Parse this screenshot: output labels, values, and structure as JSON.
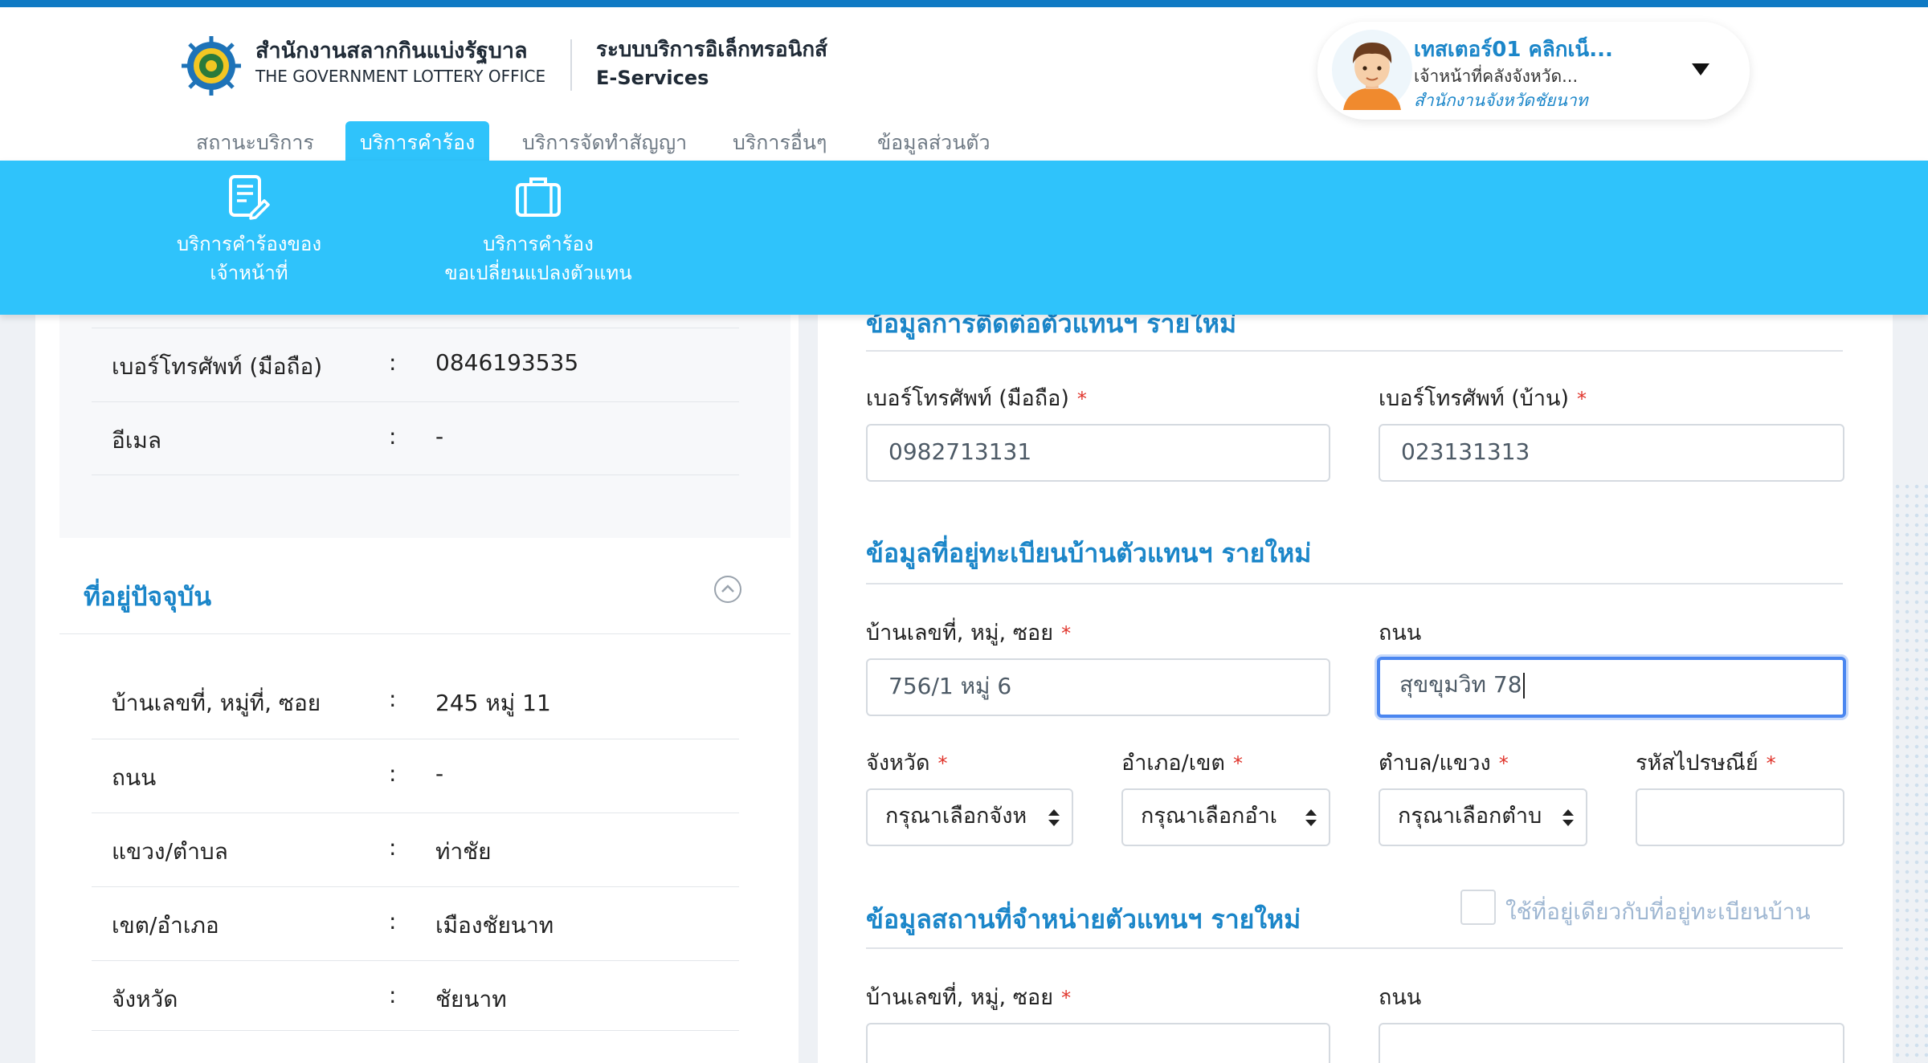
{
  "header": {
    "org_name_th": "สำนักงานสลากกินแบ่งรัฐบาล",
    "org_name_en": "THE GOVERNMENT LOTTERY OFFICE",
    "system_name_th": "ระบบบริการอิเล็กทรอนิกส์",
    "system_name_en": "E-Services"
  },
  "user": {
    "name": "เทสเตอร์01 คลิกเน็...",
    "role": "เจ้าหน้าที่คลังจังหวัด...",
    "office": "สำนักงานจังหวัดชัยนาท"
  },
  "tabs": [
    {
      "label": "สถานะบริการ"
    },
    {
      "label": "บริการคำร้อง"
    },
    {
      "label": "บริการจัดทำสัญญา"
    },
    {
      "label": "บริการอื่นๆ"
    },
    {
      "label": "ข้อมูลส่วนตัว"
    }
  ],
  "subnav": [
    {
      "line1": "บริการคำร้องของ",
      "line2": "เจ้าหน้าที่"
    },
    {
      "line1": "บริการคำร้อง",
      "line2": "ขอเปลี่ยนแปลงตัวแทน"
    }
  ],
  "left": {
    "contact_rows": [
      {
        "label": "เบอร์โทรศัพท์ (มือถือ)",
        "value": "0846193535"
      },
      {
        "label": "อีเมล",
        "value": "-"
      }
    ],
    "address_title": "ที่อยู่ปัจจุบัน",
    "address_rows": [
      {
        "label": "บ้านเลขที่, หมู่ที่, ซอย",
        "value": "245 หมู่ 11"
      },
      {
        "label": "ถนน",
        "value": "-"
      },
      {
        "label": "แขวง/ตำบล",
        "value": "ท่าชัย"
      },
      {
        "label": "เขต/อำเภอ",
        "value": "เมืองชัยนาท"
      },
      {
        "label": "จังหวัด",
        "value": "ชัยนาท"
      }
    ],
    "separator": ":"
  },
  "right": {
    "contact_title": "ข้อมูลการติดต่อตัวแทนฯ รายใหม่",
    "mobile_label": "เบอร์โทรศัพท์ (มือถือ)",
    "mobile_value": "0982713131",
    "home_phone_label": "เบอร์โทรศัพท์ (บ้าน)",
    "home_phone_value": "023131313",
    "reg_address_title": "ข้อมูลที่อยู่ทะเบียนบ้านตัวแทนฯ รายใหม่",
    "house_no_label": "บ้านเลขที่, หมู่, ซอย",
    "house_no_value": "756/1 หมู่ 6",
    "road_label": "ถนน",
    "road_value": "สุขขุมวิท 78",
    "province_label": "จังหวัด",
    "province_placeholder": "กรุณาเลือกจังห",
    "district_label": "อำเภอ/เขต",
    "district_placeholder": "กรุณาเลือกอำเ",
    "subdistrict_label": "ตำบล/แขวง",
    "subdistrict_placeholder": "กรุณาเลือกตำบ",
    "postal_label": "รหัสไปรษณีย์",
    "postal_value": "",
    "shop_title": "ข้อมูลสถานที่จำหน่ายตัวแทนฯ รายใหม่",
    "same_address_label": "ใช้ที่อยู่เดียวกับที่อยู่ทะเบียนบ้าน",
    "shop_house_no_label": "บ้านเลขที่, หมู่, ซอย",
    "shop_road_label": "ถนน",
    "required_mark": "*"
  },
  "colors": {
    "primary_blue": "#1b86c9",
    "accent_cyan": "#2fc3fb",
    "required_red": "#e0342b",
    "focus_blue": "#4a86f0"
  },
  "icons": [
    "emblem-logo",
    "user-avatar",
    "dropdown-caret-icon",
    "document-edit-icon",
    "briefcase-icon",
    "collapse-up-icon",
    "select-arrows-icon"
  ]
}
